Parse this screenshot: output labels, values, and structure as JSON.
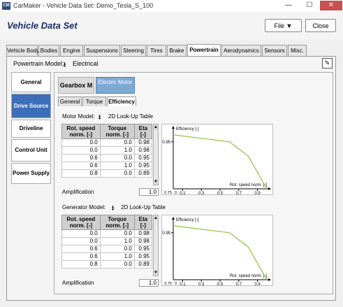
{
  "window": {
    "app_icon": "CM",
    "title": "CarMaker - Vehicle Data Set: Demo_Tesla_S_100",
    "controls": {
      "minimize": "—",
      "maximize": "☐",
      "close": "✕"
    }
  },
  "header": {
    "title": "Vehicle Data Set",
    "file_button": "File ▼",
    "close_button": "Close"
  },
  "tabs": [
    {
      "label": "Vehicle Body"
    },
    {
      "label": "Bodies"
    },
    {
      "label": "Engine"
    },
    {
      "label": "Suspensions"
    },
    {
      "label": "Steering"
    },
    {
      "label": "Tires"
    },
    {
      "label": "Brake"
    },
    {
      "label": "Powertrain",
      "active": true
    },
    {
      "label": "Aerodynamics"
    },
    {
      "label": "Sensors"
    },
    {
      "label": "Misc."
    }
  ],
  "powertrain": {
    "model_label": "Powertrain Model:",
    "model_value": "Electrical",
    "download_icon": "⭳",
    "edit_icon": "✎"
  },
  "sidebar": [
    {
      "label": "General"
    },
    {
      "label": "Drive Source",
      "active": true
    },
    {
      "label": "Driveline"
    },
    {
      "label": "Control Unit"
    },
    {
      "label": "Power Supply"
    }
  ],
  "source_buttons": {
    "gearbox": "Gearbox M",
    "electric_motor": "Electric Motor"
  },
  "subtabs": [
    {
      "label": "General"
    },
    {
      "label": "Torque"
    },
    {
      "label": "Efficiency",
      "active": true
    }
  ],
  "motor": {
    "model_label": "Motor Model:",
    "model_value": "2D Look-Up Table",
    "columns": [
      "Rot. speed norm. [-]",
      "Torque norm. [-]",
      "Eta [-]"
    ],
    "rows": [
      [
        "0.0",
        "0.0",
        "0.98"
      ],
      [
        "0.0",
        "1.0",
        "0.98"
      ],
      [
        "0.6",
        "0.0",
        "0.95"
      ],
      [
        "0.6",
        "1.0",
        "0.95"
      ],
      [
        "0.8",
        "0.0",
        "0.89"
      ]
    ],
    "amplification_label": "Amplification",
    "amplification_value": "1.0"
  },
  "generator": {
    "model_label": "Generator Model:",
    "model_value": "2D Look-Up Table",
    "columns": [
      "Rot. speed norm. [-]",
      "Torque norm. [-]",
      "Eta [-]"
    ],
    "rows": [
      [
        "0.0",
        "0.0",
        "0.98"
      ],
      [
        "0.0",
        "1.0",
        "0.98"
      ],
      [
        "0.6",
        "0.0",
        "0.95"
      ],
      [
        "0.6",
        "1.0",
        "0.95"
      ],
      [
        "0.8",
        "0.0",
        "0.89"
      ]
    ],
    "amplification_label": "Amplification",
    "amplification_value": "1.0"
  },
  "chart_data": [
    {
      "type": "line",
      "title": "",
      "xlabel": "Rot. speed norm. [-]",
      "ylabel": "Efficiency [-]",
      "x": [
        0.0,
        0.6,
        0.8,
        1.0
      ],
      "y": [
        0.98,
        0.95,
        0.89,
        0.75
      ],
      "xlim": [
        0.0,
        1.0
      ],
      "ylim": [
        0.75,
        1.0
      ],
      "xticks": [
        "0.1",
        "0.3",
        "0.5",
        "0.7",
        "0.9"
      ],
      "yticks": [
        "0.95"
      ],
      "origin_x": "0",
      "origin_y": "0.75",
      "line_color": "#8cc63f"
    },
    {
      "type": "line",
      "title": "",
      "xlabel": "Rot. speed norm. [-]",
      "ylabel": "Efficiency [-]",
      "x": [
        0.0,
        0.6,
        0.8,
        1.0
      ],
      "y": [
        0.98,
        0.95,
        0.89,
        0.75
      ],
      "xlim": [
        0.0,
        1.0
      ],
      "ylim": [
        0.75,
        1.0
      ],
      "xticks": [
        "0.1",
        "0.3",
        "0.5",
        "0.7",
        "0.9"
      ],
      "yticks": [
        "0.95"
      ],
      "origin_x": "0",
      "origin_y": "0.75",
      "line_color": "#8cc63f"
    }
  ]
}
